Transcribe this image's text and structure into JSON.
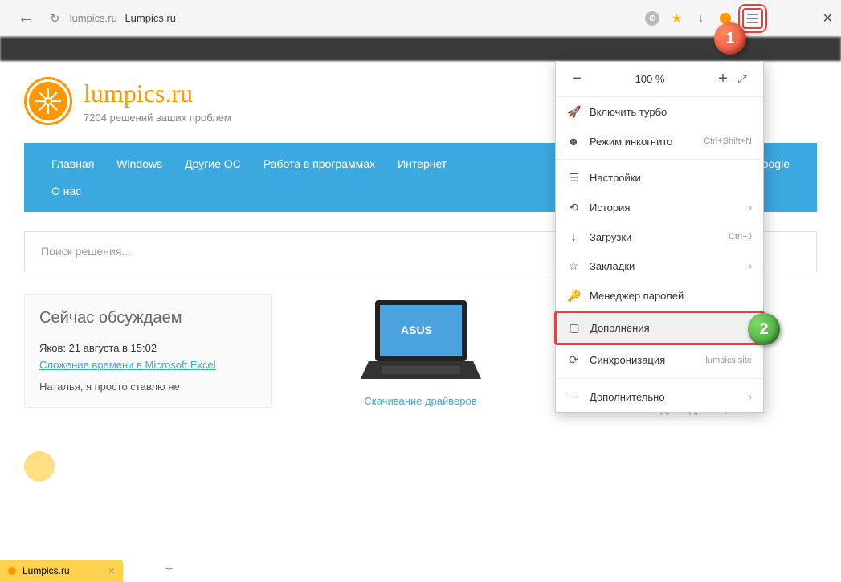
{
  "addressbar": {
    "domain": "lumpics.ru",
    "title": "Lumpics.ru"
  },
  "zoom": {
    "value": "100 %"
  },
  "menu": {
    "turbo": "Включить турбо",
    "incognito": "Режим инкогнито",
    "incognito_key": "Ctrl+Shift+N",
    "settings": "Настройки",
    "history": "История",
    "downloads": "Загрузки",
    "downloads_key": "Ctrl+J",
    "bookmarks": "Закладки",
    "passwords": "Менеджер паролей",
    "addons": "Дополнения",
    "sync": "Синхронизация",
    "sync_site": "lumpics.site",
    "more": "Дополнительно"
  },
  "site": {
    "name": "lumpics.ru",
    "tagline": "7204 решений ваших проблем"
  },
  "nav": {
    "home": "Главная",
    "windows": "Windows",
    "other_os": "Другие ОС",
    "programs": "Работа в программах",
    "internet": "Интернет",
    "about": "О нас",
    "google": "oogle"
  },
  "search": {
    "placeholder": "Поиск решения..."
  },
  "discuss": {
    "title": "Сейчас обсуждаем",
    "author": "Яков: 21 августа в 15:02",
    "link": "Сложение времени в Microsoft Excel",
    "reply": "Наталья, я просто ставлю не"
  },
  "card_laptop": {
    "link": "Скачивание драйверов"
  },
  "card_printer": {
    "link": "Загрузка драйверов"
  },
  "tab": {
    "label": "Lumpics.ru"
  },
  "badges": {
    "one": "1",
    "two": "2"
  }
}
